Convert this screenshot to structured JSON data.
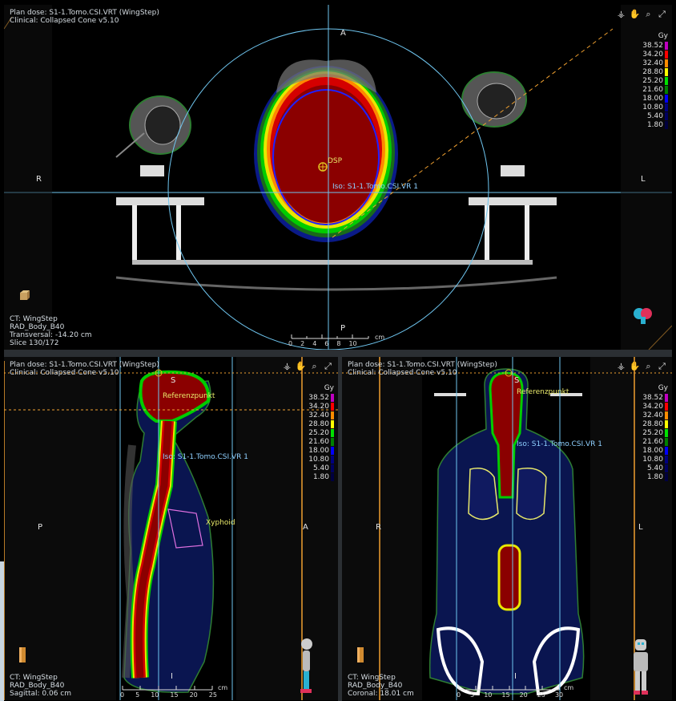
{
  "colors": {
    "crosshair": "#6fc6f0",
    "orange": "#f0a030",
    "dose_red": "#8b0000",
    "yellow": "#e8e86a"
  },
  "transversal": {
    "header": [
      "Plan dose: S1-1.Tomo.CSI.VRT (WingStep)",
      "Clinical: Collapsed Cone v5.10"
    ],
    "footer": [
      "CT: WingStep",
      "RAD_Body_B40",
      "Transversal: -14.20 cm",
      "Slice 130/172"
    ],
    "orient": {
      "top": "A",
      "bottom": "P",
      "left": "R",
      "right": "L"
    },
    "labels": {
      "dsp": "DSP",
      "iso": "Iso: S1-1.Tomo.CSI.VR 1"
    },
    "ruler": {
      "ticks": [
        "0",
        "2",
        "4",
        "6",
        "8",
        "10"
      ],
      "unit": "cm"
    }
  },
  "sagittal": {
    "header": [
      "Plan dose: S1-1.Tomo.CSI.VRT (WingStep)",
      "Clinical: Collapsed Cone v5.10"
    ],
    "footer": [
      "CT: WingStep",
      "RAD_Body_B40",
      "Sagittal: 0.06 cm"
    ],
    "orient": {
      "top": "S",
      "bottom": "I",
      "left": "P",
      "right": "A"
    },
    "labels": {
      "ref": "Referenzpunkt",
      "iso": "Iso: S1-1.Tomo.CSI.VR 1",
      "xyphoid": "Xyphoid"
    },
    "ruler": {
      "ticks": [
        "0",
        "5",
        "10",
        "15",
        "20",
        "25"
      ],
      "unit": "cm"
    }
  },
  "coronal": {
    "header": [
      "Plan dose: S1-1.Tomo.CSI.VRT (WingStep)",
      "Clinical: Collapsed Cone v5.10"
    ],
    "footer": [
      "CT: WingStep",
      "RAD_Body_B40",
      "Coronal: 18.01 cm"
    ],
    "orient": {
      "top": "S",
      "bottom": "I",
      "left": "R",
      "right": "L"
    },
    "labels": {
      "ref": "Referenzpunkt",
      "iso": "Iso: S1-1.Tomo.CSI.VR 1"
    },
    "ruler": {
      "ticks": [
        "0",
        "5",
        "10",
        "15",
        "20",
        "25",
        "30"
      ],
      "unit": "cm"
    }
  },
  "legend": {
    "unit": "Gy",
    "levels": [
      {
        "value": "38.52",
        "color": "#c000c0"
      },
      {
        "value": "34.20",
        "color": "#ff0000"
      },
      {
        "value": "32.40",
        "color": "#ff8c00"
      },
      {
        "value": "28.80",
        "color": "#ffff00"
      },
      {
        "value": "25.20",
        "color": "#00e000"
      },
      {
        "value": "21.60",
        "color": "#008000"
      },
      {
        "value": "18.00",
        "color": "#0000ff"
      },
      {
        "value": "10.80",
        "color": "#000080"
      },
      {
        "value": "5.40",
        "color": "#000060"
      },
      {
        "value": "1.80",
        "color": "#000040"
      }
    ]
  },
  "toolbar": {
    "icons": [
      "lungs-icon",
      "hand-pan-icon",
      "zoom-icon",
      "fullscreen-icon"
    ]
  }
}
